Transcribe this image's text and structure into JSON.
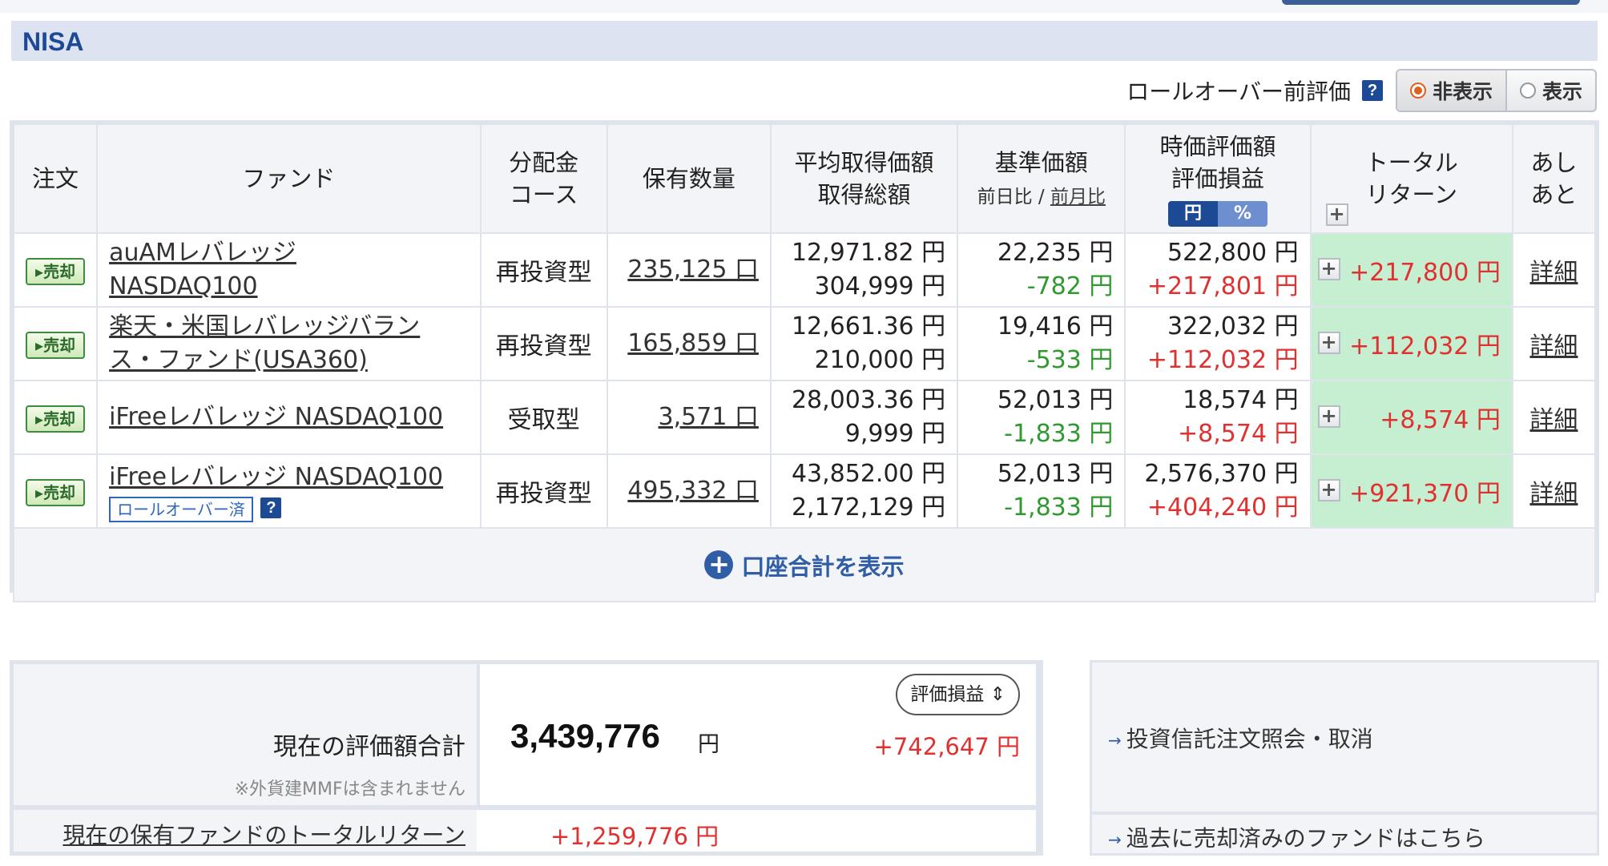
{
  "section": {
    "title": "NISA"
  },
  "rollover": {
    "label": "ロールオーバー前評価",
    "help": "?",
    "options": [
      "非表示",
      "表示"
    ],
    "selected": "非表示"
  },
  "table": {
    "headers": {
      "order": "注文",
      "fund": "ファンド",
      "distribution_1": "分配金",
      "distribution_2": "コース",
      "holdings": "保有数量",
      "avg_1": "平均取得価額",
      "avg_2": "取得総額",
      "nav_1": "基準価額",
      "nav_sub_a": "前日比",
      "nav_sub_sep": "/",
      "nav_sub_b": "前月比",
      "mv_1": "時価評価額",
      "mv_2": "評価損益",
      "unit_yen": "円",
      "unit_pct": "%",
      "tr_1": "トータル",
      "tr_2": "リターン",
      "chart_1": "あし",
      "chart_2": "あと"
    },
    "sell_label": "売却",
    "detail_label": "詳細",
    "rows": [
      {
        "fund": "auAMレバレッジNASDAQ100",
        "course": "再投資型",
        "holdings": "235,125 口",
        "avg_price": "12,971.82 円",
        "total_cost": "304,999 円",
        "nav": "22,235 円",
        "nav_change": "-782 円",
        "market_value": "522,800 円",
        "unrealized": "+217,801 円",
        "total_return": "+217,800 円"
      },
      {
        "fund": "楽天・米国レバレッジバランス・ファンド(USA360)",
        "course": "再投資型",
        "holdings": "165,859 口",
        "avg_price": "12,661.36 円",
        "total_cost": "210,000 円",
        "nav": "19,416 円",
        "nav_change": "-533 円",
        "market_value": "322,032 円",
        "unrealized": "+112,032 円",
        "total_return": "+112,032 円"
      },
      {
        "fund": "iFreeレバレッジ NASDAQ100",
        "course": "受取型",
        "holdings": "3,571 口",
        "avg_price": "28,003.36 円",
        "total_cost": "9,999 円",
        "nav": "52,013 円",
        "nav_change": "-1,833 円",
        "market_value": "18,574 円",
        "unrealized": "+8,574 円",
        "total_return": "+8,574 円"
      },
      {
        "fund": "iFreeレバレッジ NASDAQ100",
        "badge": "ロールオーバー済",
        "course": "再投資型",
        "holdings": "495,332 口",
        "avg_price": "43,852.00 円",
        "total_cost": "2,172,129 円",
        "nav": "52,013 円",
        "nav_change": "-1,833 円",
        "market_value": "2,576,370 円",
        "unrealized": "+404,240 円",
        "total_return": "+921,370 円"
      }
    ],
    "show_total_link": "口座合計を表示"
  },
  "summary": {
    "total_label": "現在の評価額合計",
    "total_value": "3,439,776",
    "unit": "円",
    "note": "※外貨建MMFは含まれません",
    "select_label": "評価損益",
    "pl": "+742,647 円",
    "tr_label": "現在の保有ファンドのトータルリターン",
    "tr_value": "+1,259,776 円"
  },
  "links": {
    "order_inquiry": "投資信託注文照会・取消",
    "sold_funds": "過去に売却済みのファンドはこちら"
  },
  "colors": {
    "accent": "#1d4a95",
    "positive": "#e03030",
    "negative": "#2f9a2f",
    "tr_bg": "#c6efd1"
  }
}
